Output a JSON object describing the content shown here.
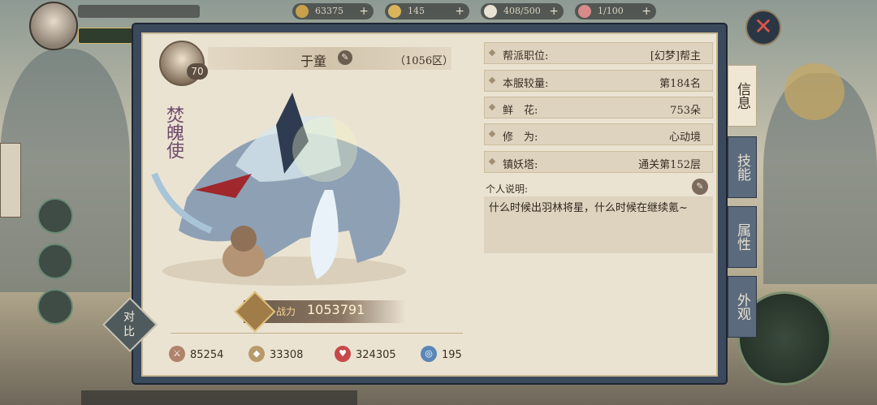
{
  "resources": [
    {
      "value": "63375",
      "icon": "copper-coin-icon",
      "color": "#c9a04a"
    },
    {
      "value": "145",
      "icon": "gold-ingot-icon",
      "color": "#d9b45a"
    },
    {
      "value": "408/500",
      "icon": "stamina-icon",
      "color": "#e8e2d4"
    },
    {
      "value": "1/100",
      "icon": "ticket-icon",
      "color": "#d98a8a"
    }
  ],
  "hero": {
    "level": "70",
    "name": "于童",
    "server": "（1056区）",
    "vertical_title": "焚魄使"
  },
  "power": {
    "label": "战力",
    "value": "1053791"
  },
  "compare_label": "对比",
  "stats": [
    {
      "value": "85254",
      "icon": "sword-icon",
      "color": "#b0826a"
    },
    {
      "value": "33308",
      "icon": "armor-icon",
      "color": "#b89a6a"
    },
    {
      "value": "324305",
      "icon": "heart-icon",
      "color": "#c64a4a"
    },
    {
      "value": "195",
      "icon": "swirl-icon",
      "color": "#5a86b8"
    }
  ],
  "info": [
    {
      "key": "帮派职位:",
      "value": "[幻梦]帮主"
    },
    {
      "key": "本服较量:",
      "value": "第184名"
    },
    {
      "key": "鲜　花:",
      "value": "753朵"
    },
    {
      "key": "修　为:",
      "value": "心动境"
    },
    {
      "key": "镇妖塔:",
      "value": "通关第152层"
    }
  ],
  "bio": {
    "label": "个人说明:",
    "text": "什么时候出羽林将星，什么时候在继续氪~"
  },
  "tabs": [
    {
      "label": "信息",
      "active": true
    },
    {
      "label": "技能",
      "active": false
    },
    {
      "label": "属性",
      "active": false
    },
    {
      "label": "外观",
      "active": false
    }
  ]
}
